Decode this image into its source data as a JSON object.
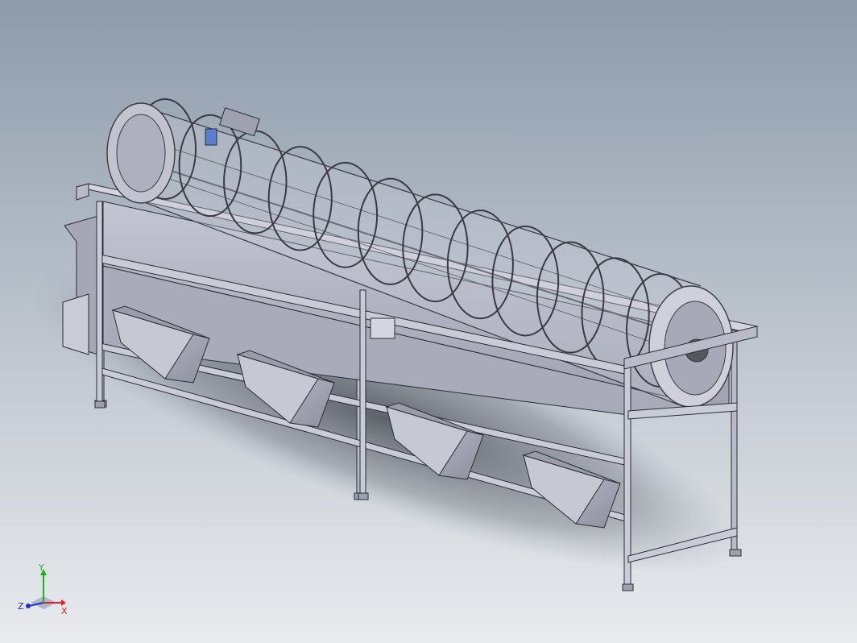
{
  "viewport": {
    "background_top": "#8e9bab",
    "background_bottom": "#e9ebee",
    "model_color": "#b9bbc9",
    "model_dark": "#7d7f8f",
    "model_light": "#dcdde6",
    "edge_color": "#2b2b33"
  },
  "triad": {
    "x_label": "X",
    "y_label": "Y",
    "z_label": "Z",
    "x_color": "#e02020",
    "y_color": "#20b020",
    "z_color": "#2030d0"
  }
}
